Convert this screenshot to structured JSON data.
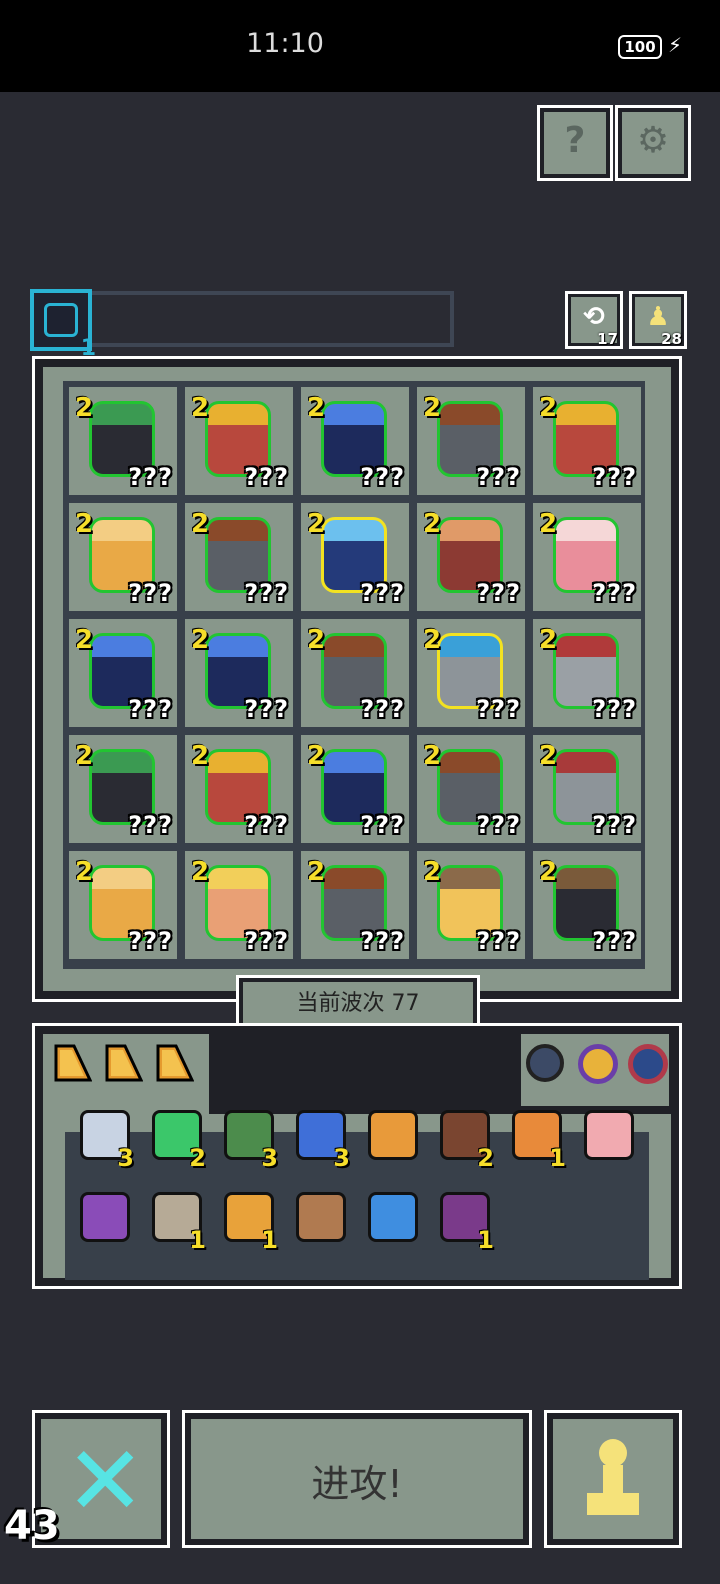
{
  "status_bar": {
    "time": "11:10",
    "battery": "100"
  },
  "top_buttons": {
    "help_glyph": "?",
    "settings_glyph": "⚙"
  },
  "info_bar": {
    "icon_count": "1"
  },
  "side_counters": {
    "refresh_count": "17",
    "unit_count": "28"
  },
  "board": {
    "question_text": "???",
    "cells": [
      {
        "level": "2",
        "color": "#2a2b33",
        "accent": "#3b9a52",
        "gold": false
      },
      {
        "level": "2",
        "color": "#b8483d",
        "accent": "#e8b030",
        "gold": false
      },
      {
        "level": "2",
        "color": "#1d2a5c",
        "accent": "#4b7de0",
        "gold": false
      },
      {
        "level": "2",
        "color": "#5a5f66",
        "accent": "#8a4a2a",
        "gold": false
      },
      {
        "level": "2",
        "color": "#b8483d",
        "accent": "#e8b030",
        "gold": false
      },
      {
        "level": "2",
        "color": "#e9a946",
        "accent": "#f3cd83",
        "gold": false
      },
      {
        "level": "2",
        "color": "#5a5f66",
        "accent": "#8a4a2a",
        "gold": false
      },
      {
        "level": "2",
        "color": "#243a7a",
        "accent": "#6cc0ee",
        "gold": true
      },
      {
        "level": "2",
        "color": "#8c3a33",
        "accent": "#e09a68",
        "gold": false
      },
      {
        "level": "2",
        "color": "#e98e9b",
        "accent": "#f5d7d7",
        "gold": false
      },
      {
        "level": "2",
        "color": "#1d2a5c",
        "accent": "#4b7de0",
        "gold": false
      },
      {
        "level": "2",
        "color": "#1d2a5c",
        "accent": "#4b7de0",
        "gold": false
      },
      {
        "level": "2",
        "color": "#5a5f66",
        "accent": "#8a4a2a",
        "gold": false
      },
      {
        "level": "2",
        "color": "#8d9499",
        "accent": "#3aa0d8",
        "gold": true
      },
      {
        "level": "2",
        "color": "#9aa0a5",
        "accent": "#b03a3a",
        "gold": false
      },
      {
        "level": "2",
        "color": "#2a2b33",
        "accent": "#3b9a52",
        "gold": false
      },
      {
        "level": "2",
        "color": "#b8483d",
        "accent": "#e8b030",
        "gold": false
      },
      {
        "level": "2",
        "color": "#1d2a5c",
        "accent": "#4b7de0",
        "gold": false
      },
      {
        "level": "2",
        "color": "#5a5f66",
        "accent": "#8a4a2a",
        "gold": false
      },
      {
        "level": "2",
        "color": "#8d9499",
        "accent": "#a83a3a",
        "gold": false
      },
      {
        "level": "2",
        "color": "#e9a946",
        "accent": "#f3cd83",
        "gold": false
      },
      {
        "level": "2",
        "color": "#e9a075",
        "accent": "#f2cf5a",
        "gold": false
      },
      {
        "level": "2",
        "color": "#5a5f66",
        "accent": "#8a4a2a",
        "gold": false
      },
      {
        "level": "2",
        "color": "#f1c35a",
        "accent": "#8b6a4a",
        "gold": false
      },
      {
        "level": "2",
        "color": "#2a2b33",
        "accent": "#7a5a3a",
        "gold": false
      }
    ]
  },
  "wave": {
    "label": "当前波次 77"
  },
  "inventory": {
    "items": [
      {
        "name": "scroll-icon",
        "count": "3",
        "color": "#c8d3e3"
      },
      {
        "name": "emerald-icon",
        "count": "2",
        "color": "#3bc76a"
      },
      {
        "name": "green-hood-icon",
        "count": "3",
        "color": "#4c8c4c"
      },
      {
        "name": "hourglass-icon",
        "count": "3",
        "color": "#3f6fd8"
      },
      {
        "name": "crown-icon",
        "count": "",
        "color": "#e89a3a"
      },
      {
        "name": "brown-idol-icon",
        "count": "2",
        "color": "#7a4530"
      },
      {
        "name": "axe-icon",
        "count": "1",
        "color": "#e88a3a"
      },
      {
        "name": "pig-icon",
        "count": "",
        "color": "#f1aab0"
      },
      {
        "name": "staff-icon",
        "count": "",
        "color": "#8a4cb8"
      },
      {
        "name": "map-icon",
        "count": "1",
        "color": "#b6aa96"
      },
      {
        "name": "ring-icon",
        "count": "1",
        "color": "#e8a23a"
      },
      {
        "name": "feather-icon",
        "count": "",
        "color": "#b07a50"
      },
      {
        "name": "blue-flame-icon",
        "count": "",
        "color": "#3f8ee0"
      },
      {
        "name": "demon-orb-icon",
        "count": "1",
        "color": "#7a3a8a"
      }
    ]
  },
  "bottom": {
    "attack_label": "进攻!"
  },
  "debug": {
    "fps": "43"
  }
}
